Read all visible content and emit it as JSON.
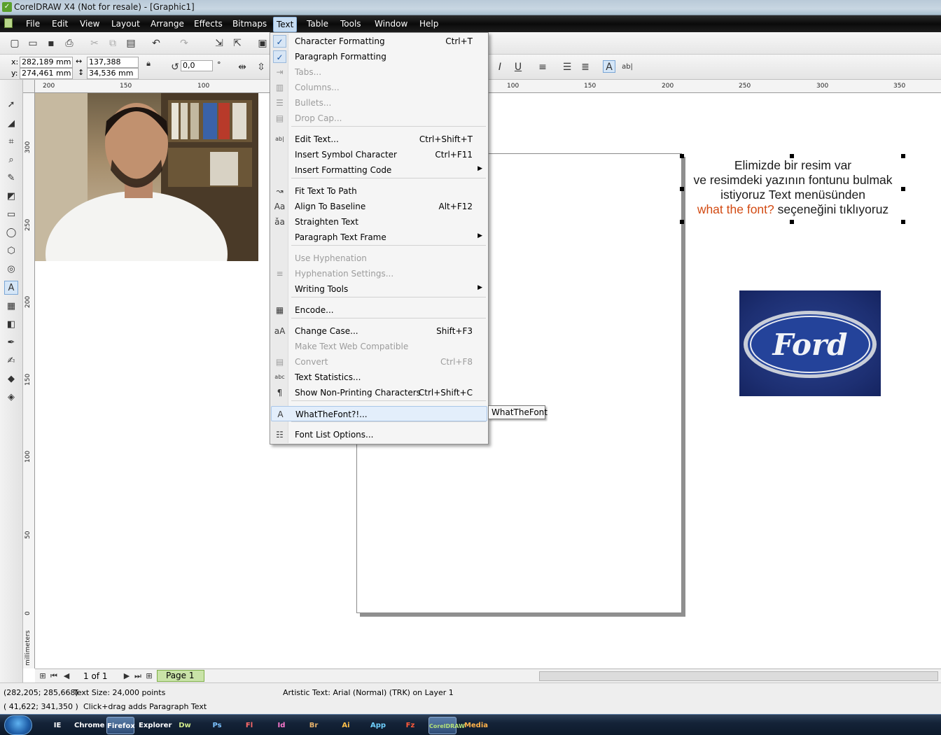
{
  "window": {
    "title": "CorelDRAW X4 (Not for resale) - [Graphic1]"
  },
  "menubar": [
    "File",
    "Edit",
    "View",
    "Layout",
    "Arrange",
    "Effects",
    "Bitmaps",
    "Text",
    "Table",
    "Tools",
    "Window",
    "Help"
  ],
  "propbar": {
    "x": "282,189 mm",
    "y": "274,461 mm",
    "w": "137,388 mm",
    "h": "34,536 mm",
    "rotation": "0,0",
    "degree": "°",
    "x_label": "x:",
    "y_label": "y:"
  },
  "hruler": [
    "200",
    "150",
    "100",
    "100",
    "150",
    "200",
    "250",
    "300",
    "350"
  ],
  "vruler": [
    "300",
    "250",
    "200",
    "150",
    "100",
    "50",
    "0"
  ],
  "vruler_unit": "millimeters",
  "text_menu": [
    {
      "label": "Character Formatting",
      "shortcut": "Ctrl+T",
      "icon": "check-icon",
      "icon_glyph": "✓",
      "checked": true
    },
    {
      "label": "Paragraph Formatting",
      "shortcut": "",
      "icon": "check-icon",
      "icon_glyph": "✓",
      "checked": true
    },
    {
      "label": "Tabs...",
      "shortcut": "",
      "icon": "tabs-icon",
      "icon_glyph": "⇥",
      "disabled": true
    },
    {
      "label": "Columns...",
      "shortcut": "",
      "icon": "columns-icon",
      "icon_glyph": "▥",
      "disabled": true
    },
    {
      "label": "Bullets...",
      "shortcut": "",
      "icon": "bullets-icon",
      "icon_glyph": "☰",
      "disabled": true
    },
    {
      "label": "Drop Cap...",
      "shortcut": "",
      "icon": "drop-cap-icon",
      "icon_glyph": "▤",
      "disabled": true
    },
    {
      "label": "Edit Text...",
      "shortcut": "Ctrl+Shift+T",
      "icon": "edit-text-icon",
      "icon_glyph": "ab|"
    },
    {
      "label": "Insert Symbol Character",
      "shortcut": "Ctrl+F11",
      "icon": "",
      "icon_glyph": ""
    },
    {
      "label": "Insert Formatting Code",
      "shortcut": "",
      "icon": "",
      "icon_glyph": "",
      "submenu": true
    },
    {
      "label": "Fit Text To Path",
      "shortcut": "",
      "icon": "fit-text-path-icon",
      "icon_glyph": "↝"
    },
    {
      "label": "Align To Baseline",
      "shortcut": "Alt+F12",
      "icon": "align-baseline-icon",
      "icon_glyph": "Aa"
    },
    {
      "label": "Straighten Text",
      "shortcut": "",
      "icon": "straighten-text-icon",
      "icon_glyph": "ǎa"
    },
    {
      "label": "Paragraph Text Frame",
      "shortcut": "",
      "icon": "",
      "icon_glyph": "",
      "submenu": true
    },
    {
      "label": "Use Hyphenation",
      "shortcut": "",
      "icon": "",
      "icon_glyph": "",
      "disabled": true
    },
    {
      "label": "Hyphenation Settings...",
      "shortcut": "",
      "icon": "hyphenation-icon",
      "icon_glyph": "≡",
      "disabled": true
    },
    {
      "label": "Writing Tools",
      "shortcut": "",
      "icon": "",
      "icon_glyph": "",
      "submenu": true
    },
    {
      "label": "Encode...",
      "shortcut": "",
      "icon": "encode-icon",
      "icon_glyph": "▦"
    },
    {
      "label": "Change Case...",
      "shortcut": "Shift+F3",
      "icon": "change-case-icon",
      "icon_glyph": "aA"
    },
    {
      "label": "Make Text Web Compatible",
      "shortcut": "",
      "icon": "",
      "icon_glyph": "",
      "disabled": true
    },
    {
      "label": "Convert",
      "shortcut": "Ctrl+F8",
      "icon": "convert-icon",
      "icon_glyph": "▤",
      "disabled": true
    },
    {
      "label": "Text Statistics...",
      "shortcut": "",
      "icon": "text-statistics-icon",
      "icon_glyph": "abc"
    },
    {
      "label": "Show Non-Printing Characters",
      "shortcut": "Ctrl+Shift+C",
      "icon": "pilcrow-icon",
      "icon_glyph": "¶"
    },
    {
      "label": "WhatTheFont?!...",
      "shortcut": "",
      "icon": "whatthefont-icon",
      "icon_glyph": "A",
      "highlight": true
    },
    {
      "label": "Font List Options...",
      "shortcut": "",
      "icon": "font-list-icon",
      "icon_glyph": "☷"
    }
  ],
  "tooltip": "WhatTheFont",
  "artistic_text": {
    "line1": "Elimizde bir resim var",
    "line2": "ve resimdeki yazının fontunu bulmak",
    "line3": "istiyoruz Text menüsünden",
    "line4_red": "what the font?",
    "line4_rest": " seçeneğini tıklıyoruz"
  },
  "logo": {
    "text": "Ford",
    "bg": "#1d2f72"
  },
  "pagenav": {
    "counter": "1 of 1",
    "tab": "Page 1"
  },
  "status": {
    "coords": "(282,205; 285,668)",
    "textsize": "Text Size: 24,000 points",
    "object": "Artistic Text: Arial (Normal) (TRK) on Layer 1",
    "cursor": "( 41,622; 341,350 )",
    "hint": "Click+drag adds Paragraph Text"
  },
  "taskbar": [
    "IE",
    "Chrome",
    "Explorer",
    "Dw",
    "Firefox",
    "Ps",
    "Fl",
    "Id",
    "Br",
    "Ai",
    "App",
    "Fz",
    "CorelDRAW",
    "Media"
  ]
}
